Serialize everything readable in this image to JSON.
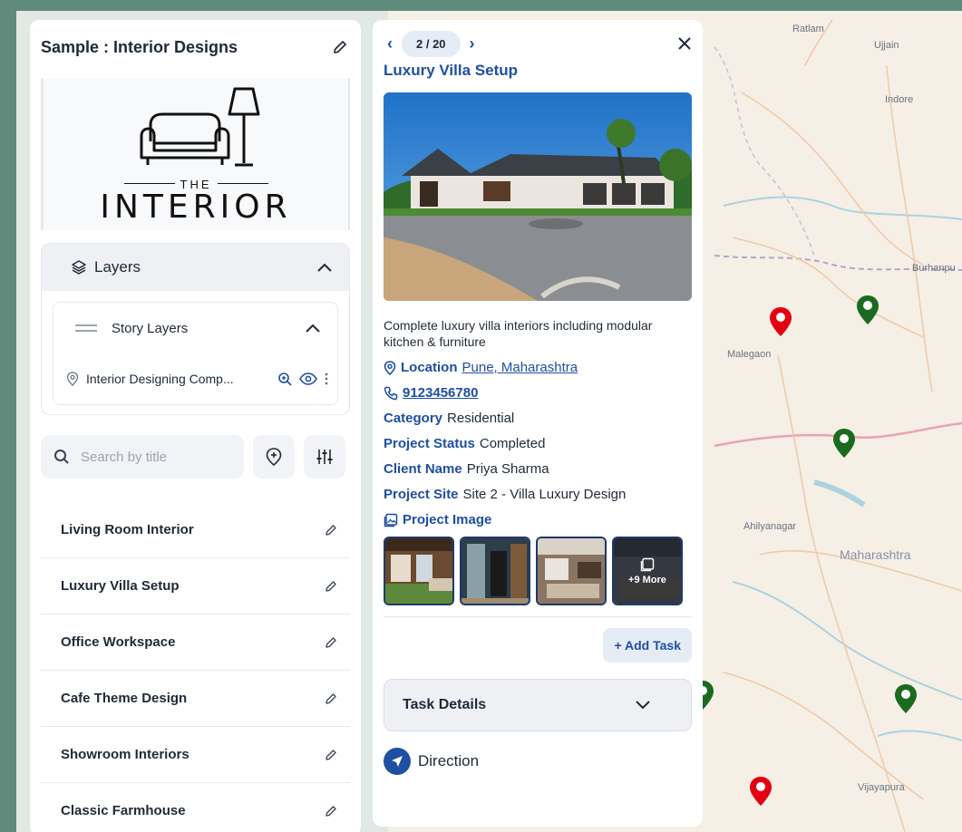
{
  "sidebar": {
    "title": "Sample : Interior Designs",
    "logo": {
      "sub": "THE",
      "main": "INTERIOR"
    },
    "layers": {
      "label": "Layers",
      "story": {
        "label": "Story Layers",
        "items": [
          {
            "label": "Interior Designing Comp..."
          }
        ]
      }
    },
    "search": {
      "placeholder": "Search by title"
    },
    "items": [
      {
        "label": "Living Room Interior"
      },
      {
        "label": "Luxury Villa Setup"
      },
      {
        "label": "Office Workspace"
      },
      {
        "label": "Cafe Theme Design"
      },
      {
        "label": "Showroom Interiors"
      },
      {
        "label": "Classic Farmhouse"
      }
    ]
  },
  "detail": {
    "pager": "2 / 20",
    "title": "Luxury Villa Setup",
    "description": "Complete luxury villa interiors including modular kitchen & furniture",
    "location_label": "Location",
    "location_value": "Pune, Maharashtra",
    "phone": "9123456780",
    "category_label": "Category",
    "category_value": "Residential",
    "status_label": "Project Status",
    "status_value": "Completed",
    "client_label": "Client Name",
    "client_value": "Priya Sharma",
    "site_label": "Project Site",
    "site_value": "Site 2 - Villa Luxury Design",
    "images_label": "Project Image",
    "more_label": "+9 More",
    "add_task": "+ Add Task",
    "task_details": "Task Details",
    "direction": "Direction"
  },
  "map": {
    "labels": {
      "ratlam": "Ratlam",
      "ujjain": "Ujjain",
      "indore": "Indore",
      "burhanpur": "Burhanpu",
      "malegaon": "Malegaon",
      "ahilyanagar": "Ahilyanagar",
      "maharashtra": "Maharashtra",
      "vijayapura": "Vijayapura"
    }
  },
  "colors": {
    "accent": "#1e4fa0",
    "pin_red": "#e3000f",
    "pin_green": "#1a6b1f"
  }
}
